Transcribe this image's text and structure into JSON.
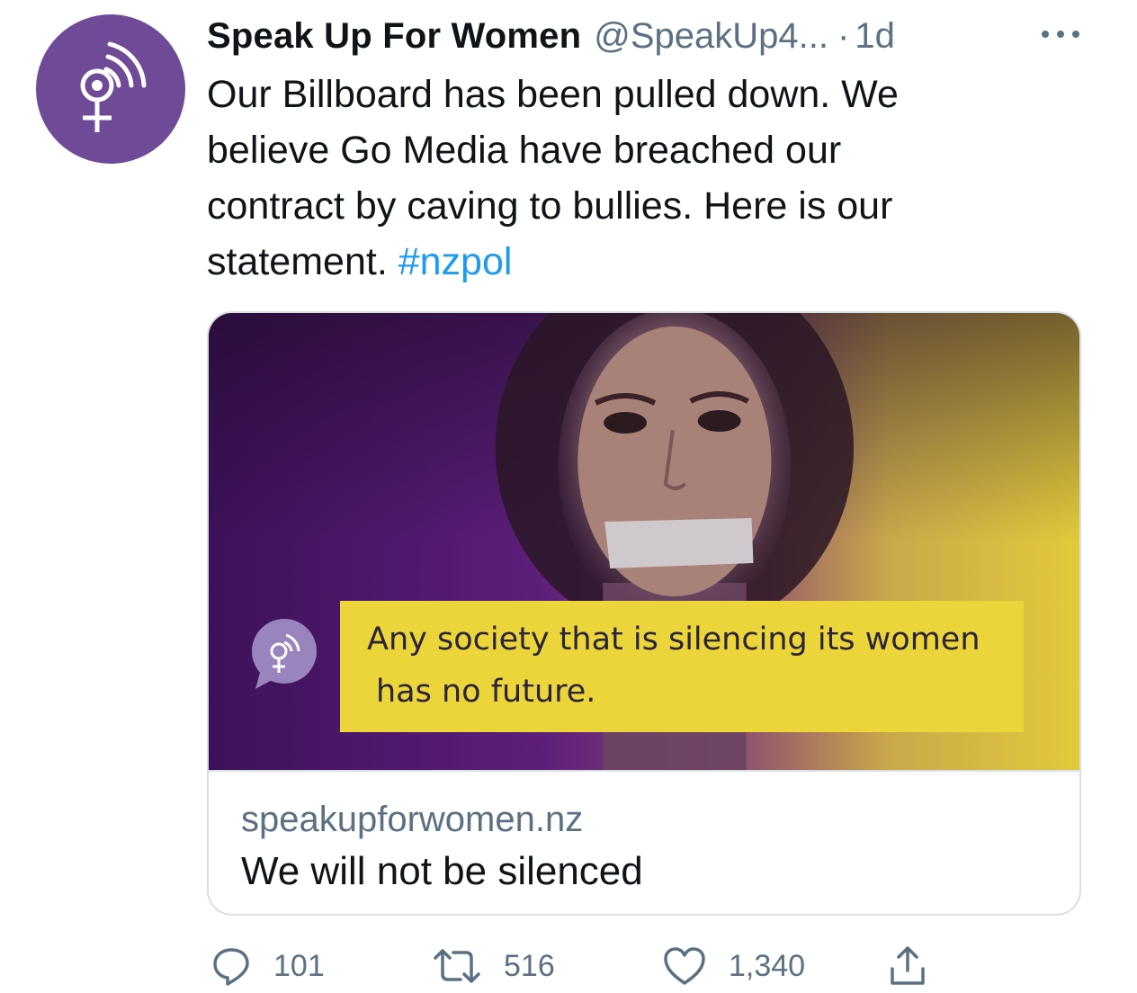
{
  "colors": {
    "avatar_bg": "#6e4a97",
    "hashtag": "#1d9bf0",
    "secondary_text": "#5b7083",
    "quote_bg": "#ecd43b",
    "image_purple": "#5d1e7a",
    "image_yellow": "#e3ca3a"
  },
  "author": {
    "display_name": "Speak Up For Women",
    "handle": "@SpeakUp4...",
    "separator": "·",
    "time": "1d",
    "avatar_icon": "venus-signal-icon"
  },
  "tweet": {
    "text_lines": [
      "Our Billboard has been pulled down. We",
      "believe Go Media have breached our",
      "contract by caving to bullies. Here is our",
      "statement."
    ],
    "hashtag": "#nzpol"
  },
  "card": {
    "image": {
      "quote_line1": "Any society that is silencing its women",
      "quote_line2": "has no future.",
      "logo_icon": "speech-bubble-venus-icon"
    },
    "domain": "speakupforwomen.nz",
    "title": "We will not be silenced"
  },
  "actions": {
    "reply_count": "101",
    "retweet_count": "516",
    "like_count": "1,340",
    "icons": [
      "reply-icon",
      "retweet-icon",
      "like-icon",
      "share-icon"
    ]
  }
}
